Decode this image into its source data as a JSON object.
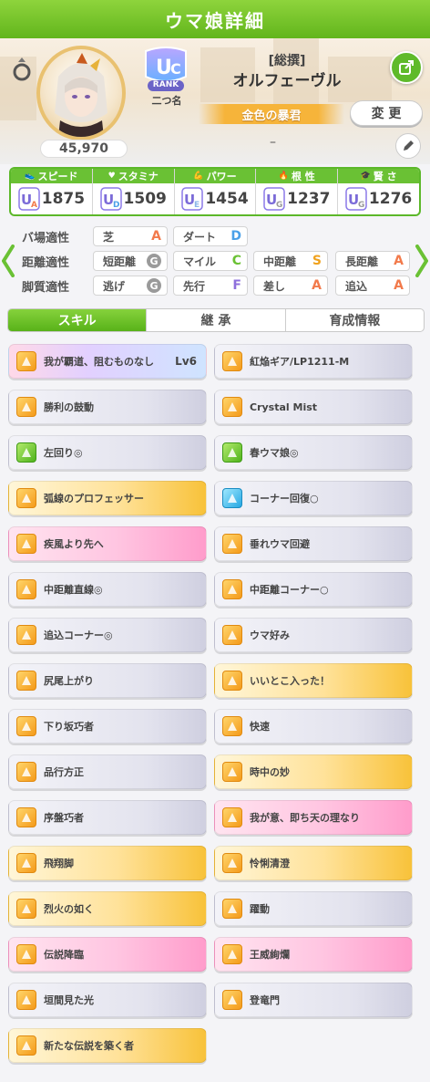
{
  "header": {
    "title": "ウマ娘詳細"
  },
  "profile": {
    "fans": "45,970",
    "rank_sub": "二つ名",
    "rank_label": "RANK",
    "epithet": "[総撰]",
    "name": "オルフェーヴル",
    "title": "金色の暴君",
    "change_label": "変 更",
    "dash": "–"
  },
  "stats": [
    {
      "label": "スピード",
      "grade": "UA",
      "value": "1875",
      "icon": "shoe-icon"
    },
    {
      "label": "スタミナ",
      "grade": "UD",
      "value": "1509",
      "icon": "heart-icon"
    },
    {
      "label": "パワー",
      "grade": "UE",
      "value": "1454",
      "icon": "muscle-icon"
    },
    {
      "label": "根 性",
      "grade": "UG",
      "value": "1237",
      "icon": "flame-icon"
    },
    {
      "label": "賢 さ",
      "grade": "UG",
      "value": "1276",
      "icon": "graduation-cap-icon"
    }
  ],
  "aptitude": {
    "rows": [
      {
        "label": "バ場適性",
        "cells": [
          {
            "name": "芝",
            "grade": "A"
          },
          {
            "name": "ダート",
            "grade": "D"
          }
        ]
      },
      {
        "label": "距離適性",
        "cells": [
          {
            "name": "短距離",
            "grade": "G"
          },
          {
            "name": "マイル",
            "grade": "C"
          },
          {
            "name": "中距離",
            "grade": "S"
          },
          {
            "name": "長距離",
            "grade": "A"
          }
        ]
      },
      {
        "label": "脚質適性",
        "cells": [
          {
            "name": "逃げ",
            "grade": "G"
          },
          {
            "name": "先行",
            "grade": "F"
          },
          {
            "name": "差し",
            "grade": "A"
          },
          {
            "name": "追込",
            "grade": "A"
          }
        ]
      }
    ]
  },
  "colors": {
    "accent": "#62b51c",
    "grade_S": "#f0a21e",
    "grade_A": "#f27a4b",
    "grade_C": "#6ac134",
    "grade_D": "#4aa0e8",
    "grade_F": "#8e6fdc",
    "grade_G": "#9a9a9a"
  },
  "tabs": [
    {
      "label": "スキル",
      "active": true
    },
    {
      "label": "継 承"
    },
    {
      "label": "育成情報"
    }
  ],
  "skills": [
    {
      "name": "我が覇道、阻むものなし",
      "level": "Lv6",
      "style": "unique",
      "icon": "orange"
    },
    {
      "name": "紅焔ギア/LP1211-M",
      "style": "normal",
      "icon": "orange"
    },
    {
      "name": "勝利の鼓動",
      "style": "normal",
      "icon": "orange"
    },
    {
      "name": "Crystal Mist",
      "style": "normal",
      "icon": "orange"
    },
    {
      "name": "左回り◎",
      "style": "normal",
      "icon": "green"
    },
    {
      "name": "春ウマ娘◎",
      "style": "normal",
      "icon": "green"
    },
    {
      "name": "弧線のプロフェッサー",
      "style": "gold",
      "icon": "orange"
    },
    {
      "name": "コーナー回復○",
      "style": "normal",
      "icon": "blue"
    },
    {
      "name": "疾風より先へ",
      "style": "pink",
      "icon": "orange"
    },
    {
      "name": "垂れウマ回避",
      "style": "normal",
      "icon": "orange"
    },
    {
      "name": "中距離直線◎",
      "style": "normal",
      "icon": "orange"
    },
    {
      "name": "中距離コーナー○",
      "style": "normal",
      "icon": "orange"
    },
    {
      "name": "追込コーナー◎",
      "style": "normal",
      "icon": "orange"
    },
    {
      "name": "ウマ好み",
      "style": "normal",
      "icon": "orange"
    },
    {
      "name": "尻尾上がり",
      "style": "normal",
      "icon": "orange"
    },
    {
      "name": "いいとこ入った！",
      "style": "gold",
      "icon": "orange"
    },
    {
      "name": "下り坂巧者",
      "style": "normal",
      "icon": "orange"
    },
    {
      "name": "快速",
      "style": "normal",
      "icon": "orange"
    },
    {
      "name": "品行方正",
      "style": "normal",
      "icon": "orange"
    },
    {
      "name": "時中の妙",
      "style": "gold",
      "icon": "orange"
    },
    {
      "name": "序盤巧者",
      "style": "normal",
      "icon": "orange"
    },
    {
      "name": "我が意、即ち天の理なり",
      "style": "pink",
      "icon": "orange"
    },
    {
      "name": "飛翔脚",
      "style": "gold",
      "icon": "orange"
    },
    {
      "name": "怜悧清澄",
      "style": "gold",
      "icon": "orange"
    },
    {
      "name": "烈火の如く",
      "style": "gold",
      "icon": "orange"
    },
    {
      "name": "躍動",
      "style": "normal",
      "icon": "orange"
    },
    {
      "name": "伝説降臨",
      "style": "pink",
      "icon": "orange"
    },
    {
      "name": "王威絢爛",
      "style": "pink",
      "icon": "orange"
    },
    {
      "name": "垣間見た光",
      "style": "normal",
      "icon": "orange"
    },
    {
      "name": "登竜門",
      "style": "normal",
      "icon": "orange"
    },
    {
      "name": "新たな伝説を築く者",
      "style": "gold",
      "icon": "orange"
    }
  ]
}
